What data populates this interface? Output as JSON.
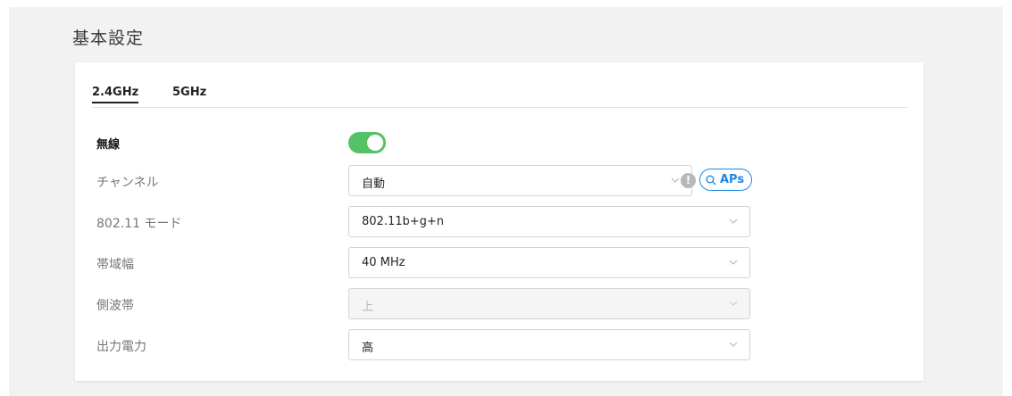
{
  "page": {
    "title": "基本設定"
  },
  "tabs": [
    {
      "label": "2.4GHz",
      "active": true
    },
    {
      "label": "5GHz",
      "active": false
    }
  ],
  "wireless": {
    "label": "無線",
    "enabled": true
  },
  "channel": {
    "label": "チャンネル",
    "value": "自動",
    "info_glyph": "!",
    "aps_button_label": "APs"
  },
  "mode": {
    "label": "802.11 モード",
    "value": "802.11b+g+n"
  },
  "bandwidth": {
    "label": "帯域幅",
    "value": "40 MHz"
  },
  "sideband": {
    "label": "側波帯",
    "value": "上",
    "disabled": true
  },
  "power": {
    "label": "出力電力",
    "value": "高"
  },
  "colors": {
    "toggle_on": "#54c266",
    "accent": "#1e88e5",
    "page_bg": "#f2f2f2"
  },
  "icons": {
    "chevron": "chevron-down-icon",
    "info": "info-icon",
    "search": "search-icon"
  }
}
